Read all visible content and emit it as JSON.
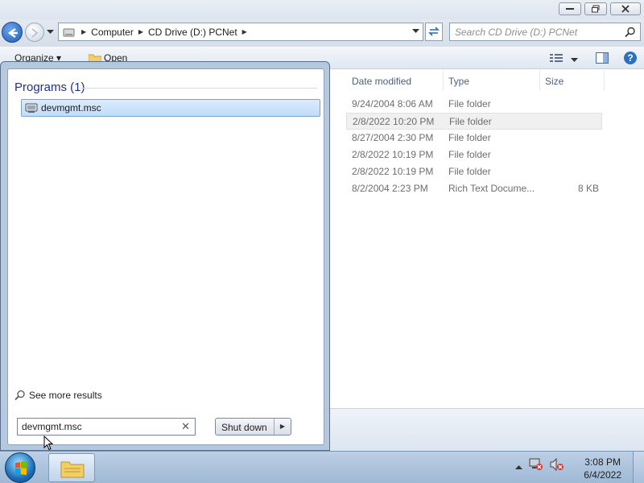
{
  "explorer": {
    "breadcrumb": [
      "Computer",
      "CD Drive (D:) PCNet"
    ],
    "search_placeholder": "Search CD Drive (D:) PCNet",
    "commands": {
      "organize": "Organize ▾",
      "open": "Open"
    },
    "columns": {
      "date": "Date modified",
      "type": "Type",
      "size": "Size"
    },
    "rows": [
      {
        "date": "9/24/2004 8:06 AM",
        "type": "File folder",
        "size": ""
      },
      {
        "date": "2/8/2022 10:20 PM",
        "type": "File folder",
        "size": ""
      },
      {
        "date": "8/27/2004 2:30 PM",
        "type": "File folder",
        "size": ""
      },
      {
        "date": "2/8/2022 10:19 PM",
        "type": "File folder",
        "size": ""
      },
      {
        "date": "2/8/2022 10:19 PM",
        "type": "File folder",
        "size": ""
      },
      {
        "date": "8/2/2004 2:23 PM",
        "type": "Rich Text Docume...",
        "size": "8 KB"
      }
    ]
  },
  "start_menu": {
    "section_header": "Programs (1)",
    "results": [
      {
        "label": "devmgmt.msc"
      }
    ],
    "see_more": "See more results",
    "search_value": "devmgmt.msc",
    "shutdown_label": "Shut down"
  },
  "taskbar": {
    "time": "3:08 PM",
    "date": "6/4/2022"
  },
  "colors": {
    "selection": "#c1dcfc",
    "header_text": "#1e3287",
    "taskbar": "#b0c6df"
  }
}
